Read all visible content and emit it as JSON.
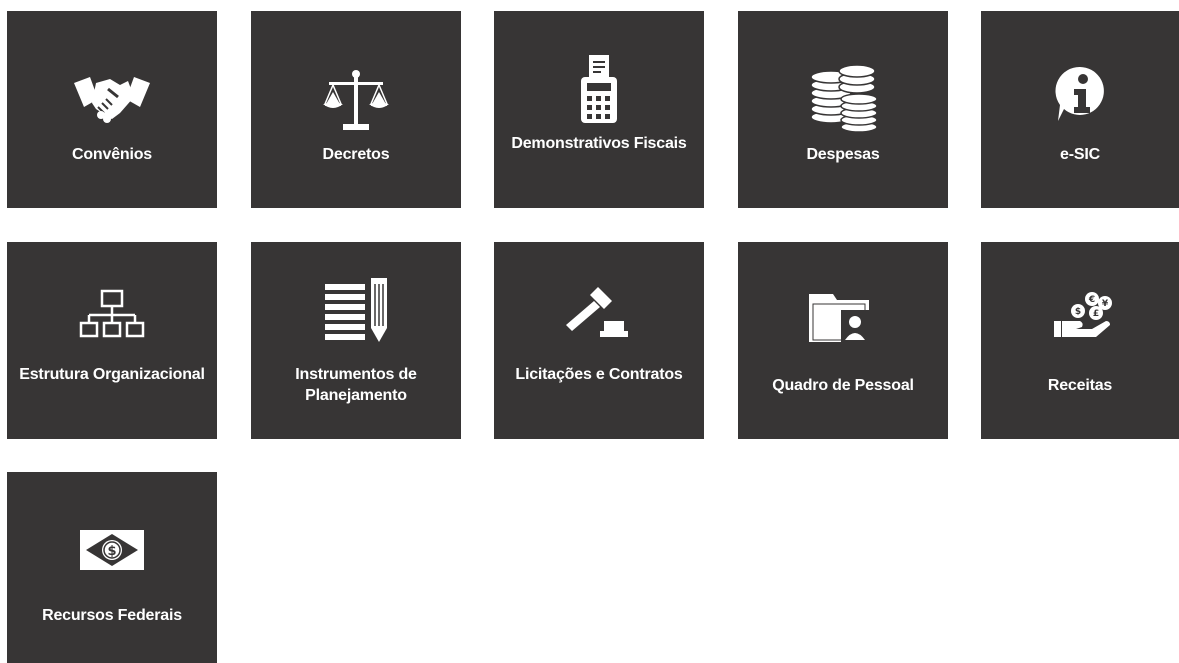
{
  "tiles": [
    {
      "label": "Convênios",
      "icon": "handshake-icon"
    },
    {
      "label": "Decretos",
      "icon": "scales-icon"
    },
    {
      "label": "Demonstrativos Fiscais",
      "icon": "calculator-receipt-icon"
    },
    {
      "label": "Despesas",
      "icon": "coin-stacks-icon"
    },
    {
      "label": "e-SIC",
      "icon": "info-bubble-icon"
    },
    {
      "label": "Estrutura Organizacional",
      "icon": "org-chart-icon"
    },
    {
      "label": "Instrumentos de Planejamento",
      "icon": "list-pencil-icon"
    },
    {
      "label": "Licitações e Contratos",
      "icon": "gavel-icon"
    },
    {
      "label": "Quadro de Pessoal",
      "icon": "personnel-folder-icon"
    },
    {
      "label": "Receitas",
      "icon": "hand-coins-icon"
    },
    {
      "label": "Recursos Federais",
      "icon": "federal-money-icon"
    }
  ],
  "colors": {
    "tile_background": "#373535",
    "tile_text": "#ffffff",
    "page_background": "#ffffff"
  }
}
